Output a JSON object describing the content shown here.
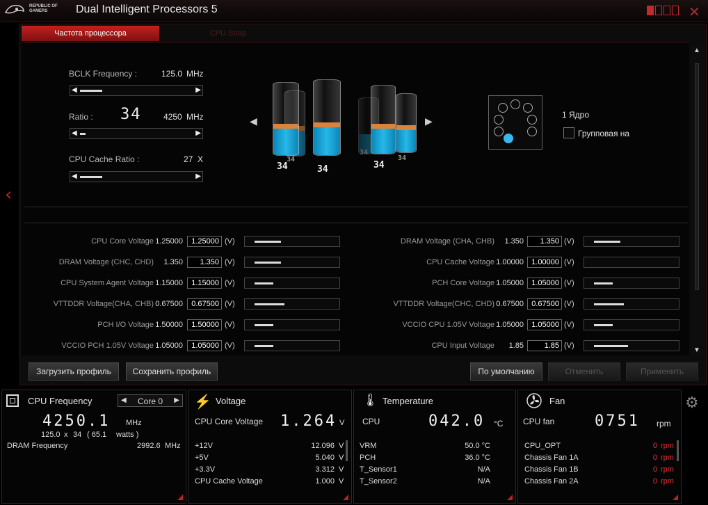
{
  "app": {
    "logo_line1": "REPUBLIC OF",
    "logo_line2": "GAMERS",
    "title": "Dual Intelligent Processors 5"
  },
  "tabs": [
    {
      "label": "Частота процессора",
      "active": true
    },
    {
      "label": "CPU Strap",
      "active": false
    }
  ],
  "freq": {
    "bclk_label": "BCLK Frequency :",
    "bclk_value": "125.0",
    "bclk_unit": "MHz",
    "ratio_label": "Ratio :",
    "ratio_big": "34",
    "ratio_mhz": "4250",
    "ratio_unit": "MHz",
    "cache_label": "CPU Cache Ratio :",
    "cache_value": "27",
    "cache_unit": "X"
  },
  "cores": {
    "labels": [
      "34",
      "34",
      "34",
      "34",
      "34",
      "34"
    ],
    "core_label": "1 Ядро",
    "group_label": "Групповая на"
  },
  "voltage_left": [
    {
      "label": "CPU Core Voltage",
      "value": "1.25000",
      "box": "1.25000",
      "unit": "(V)",
      "fill": 0.35
    },
    {
      "label": "DRAM Voltage (CHC, CHD)",
      "value": "1.350",
      "box": "1.350",
      "unit": "(V)",
      "fill": 0.35
    },
    {
      "label": "CPU System Agent Voltage",
      "value": "1.15000",
      "box": "1.15000",
      "unit": "(V)",
      "fill": 0.25
    },
    {
      "label": "VTTDDR Voltage(CHA, CHB)",
      "value": "0.67500",
      "box": "0.67500",
      "unit": "(V)",
      "fill": 0.4
    },
    {
      "label": "PCH I/O Voltage",
      "value": "1.50000",
      "box": "1.50000",
      "unit": "(V)",
      "fill": 0.25
    },
    {
      "label": "VCCIO PCH 1.05V Voltage",
      "value": "1.05000",
      "box": "1.05000",
      "unit": "(V)",
      "fill": 0.25
    }
  ],
  "voltage_right": [
    {
      "label": "DRAM Voltage (CHA, CHB)",
      "value": "1.350",
      "box": "1.350",
      "unit": "(V)",
      "fill": 0.35
    },
    {
      "label": "CPU Cache Voltage",
      "value": "1.00000",
      "box": "1.00000",
      "unit": "(V)",
      "fill": 0.0
    },
    {
      "label": "PCH Core Voltage",
      "value": "1.05000",
      "box": "1.05000",
      "unit": "(V)",
      "fill": 0.25
    },
    {
      "label": "VTTDDR Voltage(CHC, CHD)",
      "value": "0.67500",
      "box": "0.67500",
      "unit": "(V)",
      "fill": 0.4
    },
    {
      "label": "VCCIO CPU 1.05V Voltage",
      "value": "1.05000",
      "box": "1.05000",
      "unit": "(V)",
      "fill": 0.25
    },
    {
      "label": "CPU Input Voltage",
      "value": "1.85",
      "box": "1.85",
      "unit": "(V)",
      "fill": 0.45
    }
  ],
  "buttons": {
    "load": "Загрузить профиль",
    "save": "Сохранить профиль",
    "default": "По умолчанию",
    "cancel": "Отменить",
    "apply": "Применить"
  },
  "cpu_panel": {
    "title": "CPU Frequency",
    "core_select": "Core 0",
    "freq_big": "4250.1",
    "freq_unit": "MHz",
    "detail_bclk": "125.0",
    "detail_x": "x",
    "detail_ratio": "34",
    "detail_watts": "( 65.1",
    "detail_watts_unit": "watts )",
    "dram_label": "DRAM Frequency",
    "dram_value": "2992.6",
    "dram_unit": "MHz"
  },
  "voltage_panel": {
    "title": "Voltage",
    "main_label": "CPU Core Voltage",
    "main_big": "1.264",
    "main_unit": "V",
    "rows": [
      {
        "label": "+12V",
        "value": "12.096",
        "unit": "V"
      },
      {
        "label": "+5V",
        "value": "5.040",
        "unit": "V"
      },
      {
        "label": "+3.3V",
        "value": "3.312",
        "unit": "V"
      },
      {
        "label": "CPU Cache Voltage",
        "value": "1.000",
        "unit": "V"
      }
    ]
  },
  "temp_panel": {
    "title": "Temperature",
    "main_label": "CPU",
    "main_big": "042.0",
    "main_unit": "°C",
    "rows": [
      {
        "label": "VRM",
        "value": "50.0 °C"
      },
      {
        "label": "PCH",
        "value": "36.0 °C"
      },
      {
        "label": "T_Sensor1",
        "value": "N/A"
      },
      {
        "label": "T_Sensor2",
        "value": "N/A"
      }
    ]
  },
  "fan_panel": {
    "title": "Fan",
    "main_label": "CPU fan",
    "main_big": "0751",
    "main_unit": "rpm",
    "rows": [
      {
        "label": "CPU_OPT",
        "value": "0",
        "unit": "rpm"
      },
      {
        "label": "Chassis Fan 1A",
        "value": "0",
        "unit": "rpm"
      },
      {
        "label": "Chassis Fan 1B",
        "value": "0",
        "unit": "rpm"
      },
      {
        "label": "Chassis Fan 2A",
        "value": "0",
        "unit": "rpm"
      }
    ]
  },
  "colors": {
    "accent": "#c42020",
    "water": "#26b8e8",
    "band": "#d9843a"
  }
}
